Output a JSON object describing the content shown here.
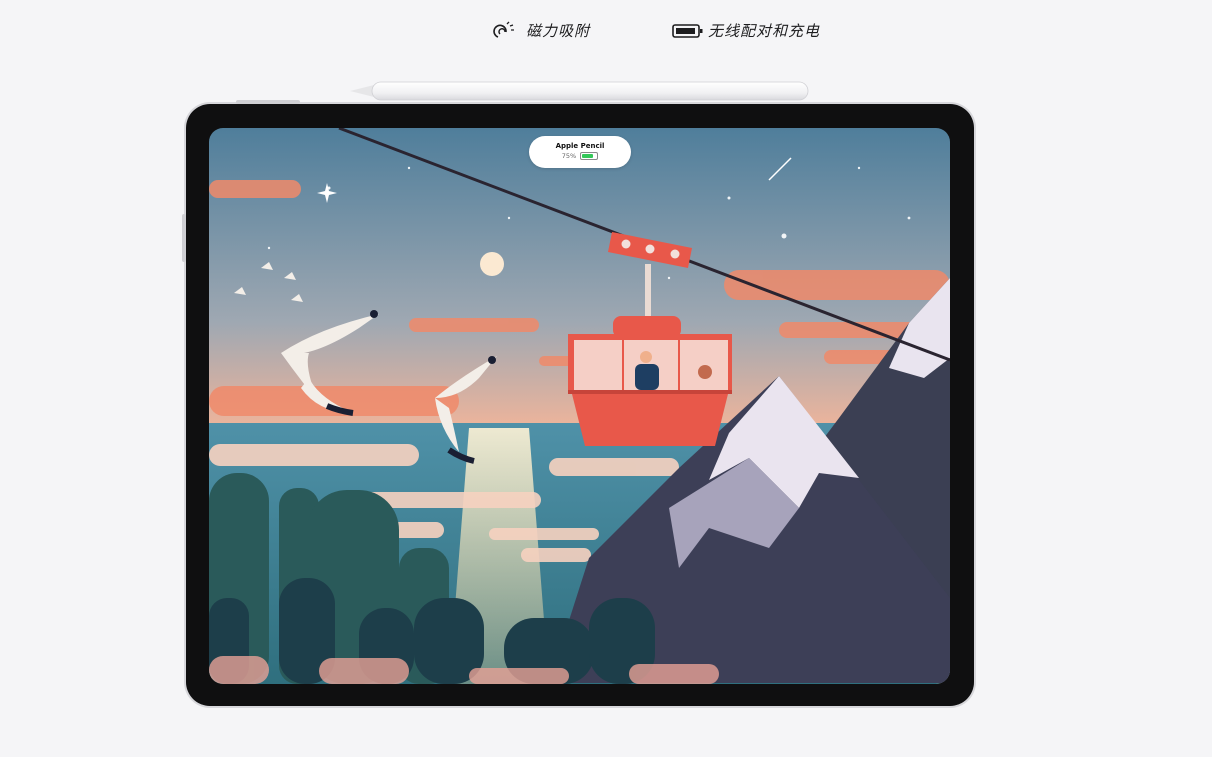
{
  "features": [
    {
      "label": "磁力吸附",
      "icon": "magnet-icon"
    },
    {
      "label": "无线配对和充电",
      "icon": "battery-icon"
    }
  ],
  "pencil_status": {
    "title": "Apple Pencil",
    "battery_text": "75%",
    "battery_level": 0.75,
    "battery_color": "#34c759"
  }
}
